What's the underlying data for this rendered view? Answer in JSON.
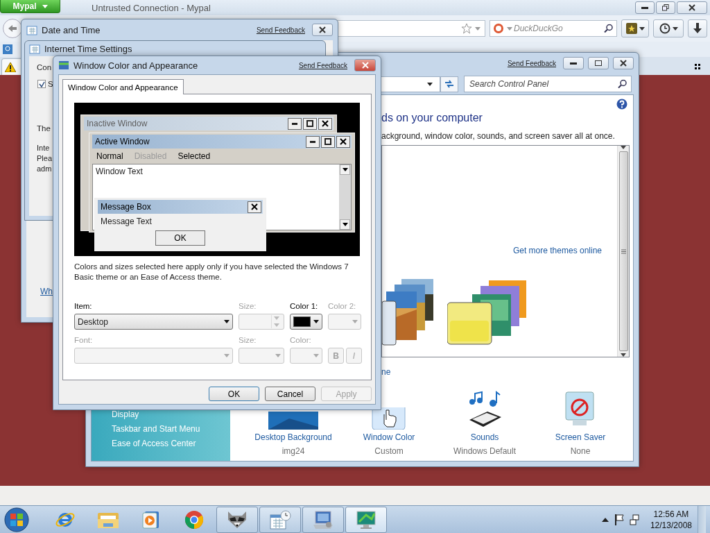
{
  "browser": {
    "menu_button": "Mypal",
    "title": "Untrusted Connection - Mypal",
    "search": {
      "placeholder": "DuckDuckGo"
    }
  },
  "control_panel": {
    "send_feedback": "Send Feedback",
    "search": {
      "placeholder": "Search Control Panel"
    },
    "heading": "ds on your computer",
    "subtitle": "ackground, window color, sounds, and screen saver all at once.",
    "more_themes_link": "Get more themes online",
    "cut_link": "ne",
    "sidebar": {
      "items": [
        "Display",
        "Taskbar and Start Menu",
        "Ease of Access Center"
      ]
    },
    "settings": [
      {
        "kind": "background",
        "label": "Desktop Background",
        "value": "img24"
      },
      {
        "kind": "color",
        "label": "Window Color",
        "value": "Custom"
      },
      {
        "kind": "sounds",
        "label": "Sounds",
        "value": "Windows Default"
      },
      {
        "kind": "saver",
        "label": "Screen Saver",
        "value": "None"
      }
    ]
  },
  "date_time": {
    "title": "Date and Time",
    "send_feedback": "Send Feedback",
    "link": "Wh",
    "internet_time": {
      "title": "Internet Time Settings",
      "line_1": "Con",
      "checkbox": {
        "label": "S",
        "checked": true
      },
      "line_2": "The",
      "paragraph": [
        "Inte",
        "Plea",
        "adm"
      ]
    }
  },
  "dialog": {
    "title": "Window Color and Appearance",
    "send_feedback": "Send Feedback",
    "tabs": [
      {
        "label": "Window Color and Appearance",
        "selected": true
      }
    ],
    "preview": {
      "inactive_title": "Inactive Window",
      "active_title": "Active Window",
      "menu": [
        {
          "label": "Normal",
          "disabled": false
        },
        {
          "label": "Disabled",
          "disabled": true
        },
        {
          "label": "Selected",
          "disabled": false
        }
      ],
      "window_text": "Window Text",
      "message_title": "Message Box",
      "message_text": "Message Text",
      "ok": "OK"
    },
    "note": "Colors and sizes selected here apply only if you have selected the Windows 7 Basic theme or an Ease of Access theme.",
    "row_1": [
      {
        "kind": "select",
        "label": "Item:",
        "value": "Desktop",
        "disabled": false
      },
      {
        "kind": "spin",
        "label": "Size:",
        "disabled": true
      },
      {
        "kind": "color",
        "label": "Color 1:",
        "color": "#000000",
        "disabled": false
      },
      {
        "kind": "color",
        "label": "Color 2:",
        "disabled": true
      }
    ],
    "row_2": [
      {
        "kind": "select",
        "label": "Font:",
        "disabled": true
      },
      {
        "kind": "select",
        "label": "Size:",
        "disabled": true
      },
      {
        "kind": "color",
        "label": "Color:",
        "disabled": true
      },
      {
        "kind": "styles",
        "bold": "B",
        "italic": "I",
        "disabled": true
      }
    ],
    "buttons": [
      {
        "label": "OK",
        "default": true,
        "disabled": false
      },
      {
        "label": "Cancel",
        "default": false,
        "disabled": false
      },
      {
        "label": "Apply",
        "default": false,
        "disabled": true
      }
    ]
  },
  "taskbar": {
    "items": [
      {
        "kind": "ie",
        "running": false,
        "selected": false
      },
      {
        "kind": "folder",
        "running": false,
        "selected": false
      },
      {
        "kind": "media",
        "running": false,
        "selected": false
      },
      {
        "kind": "chrome",
        "running": false,
        "selected": false
      },
      {
        "kind": "raccoon",
        "running": true,
        "selected": false
      },
      {
        "kind": "calendar",
        "running": true,
        "selected": false
      },
      {
        "kind": "config",
        "running": true,
        "selected": false
      },
      {
        "kind": "display",
        "running": true,
        "selected": true
      }
    ],
    "time": "12:56 AM",
    "date": "12/13/2008"
  }
}
